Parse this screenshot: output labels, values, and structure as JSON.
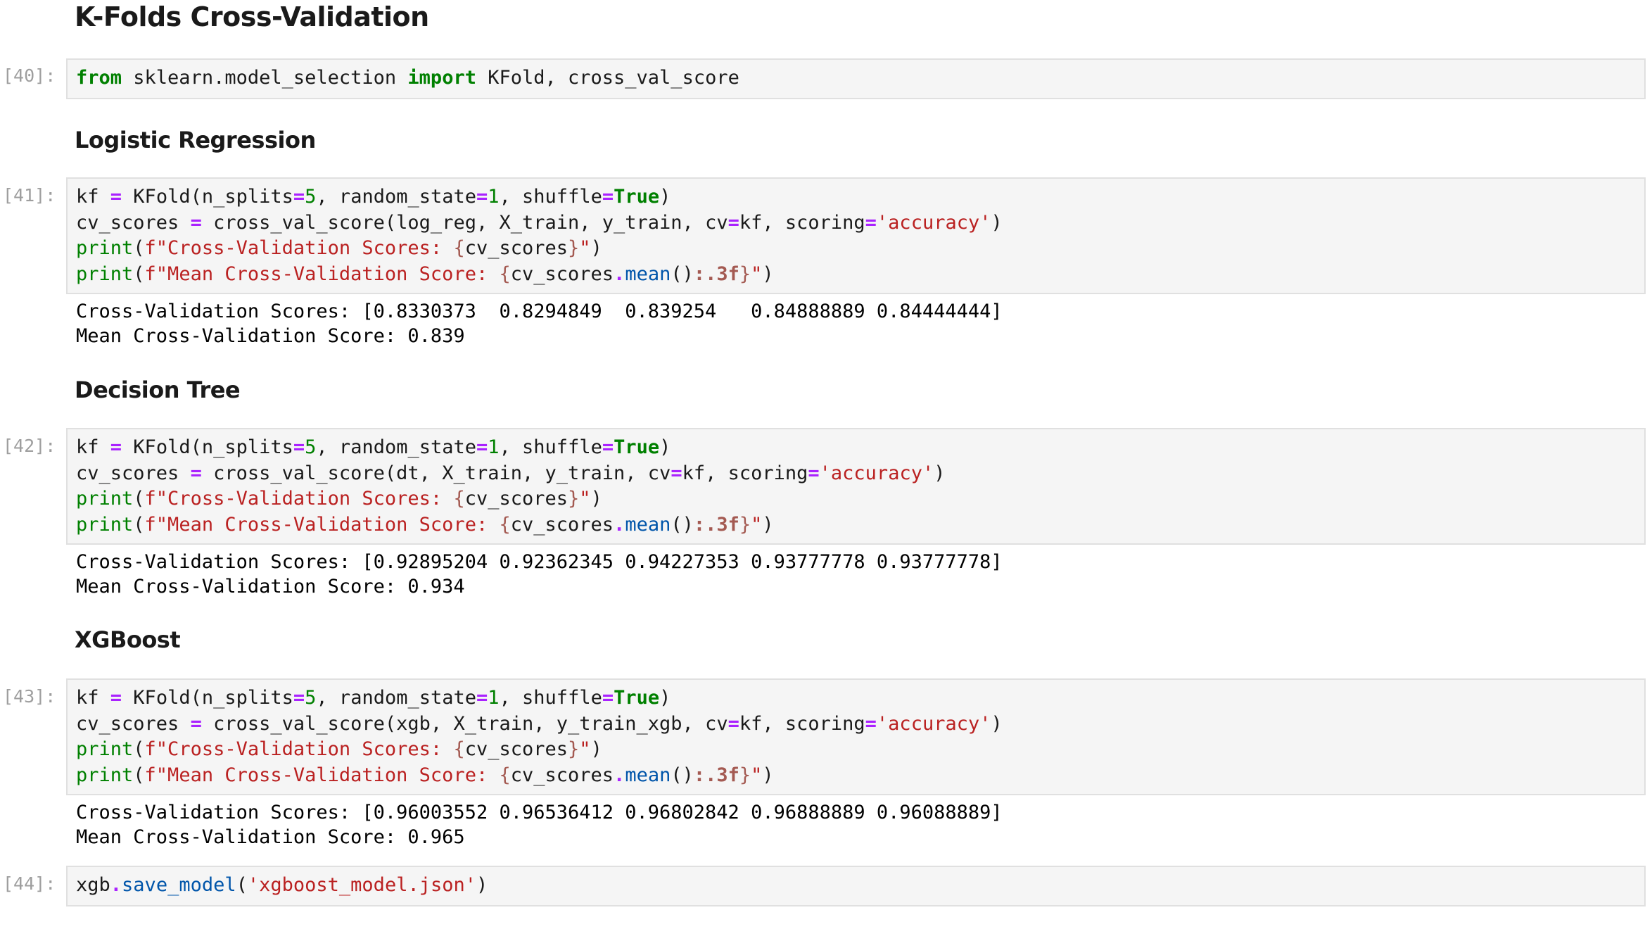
{
  "headings": {
    "main": "K-Folds Cross-Validation",
    "logreg": "Logistic Regression",
    "dtree": "Decision Tree",
    "xgb": "XGBoost"
  },
  "cells": [
    {
      "prompt": "[40]:",
      "code": [
        "from sklearn.model_selection import KFold, cross_val_score"
      ],
      "output": []
    },
    {
      "prompt": "[41]:",
      "code": [
        "kf = KFold(n_splits=5, random_state=1, shuffle=True)",
        "cv_scores = cross_val_score(log_reg, X_train, y_train, cv=kf, scoring='accuracy')",
        "print(f\"Cross-Validation Scores: {cv_scores}\")",
        "print(f\"Mean Cross-Validation Score: {cv_scores.mean():.3f}\")"
      ],
      "output": [
        "Cross-Validation Scores: [0.8330373  0.8294849  0.839254   0.84888889 0.84444444]",
        "Mean Cross-Validation Score: 0.839"
      ]
    },
    {
      "prompt": "[42]:",
      "code": [
        "kf = KFold(n_splits=5, random_state=1, shuffle=True)",
        "cv_scores = cross_val_score(dt, X_train, y_train, cv=kf, scoring='accuracy')",
        "print(f\"Cross-Validation Scores: {cv_scores}\")",
        "print(f\"Mean Cross-Validation Score: {cv_scores.mean():.3f}\")"
      ],
      "output": [
        "Cross-Validation Scores: [0.92895204 0.92362345 0.94227353 0.93777778 0.93777778]",
        "Mean Cross-Validation Score: 0.934"
      ]
    },
    {
      "prompt": "[43]:",
      "code": [
        "kf = KFold(n_splits=5, random_state=1, shuffle=True)",
        "cv_scores = cross_val_score(xgb, X_train, y_train_xgb, cv=kf, scoring='accuracy')",
        "print(f\"Cross-Validation Scores: {cv_scores}\")",
        "print(f\"Mean Cross-Validation Score: {cv_scores.mean():.3f}\")"
      ],
      "output": [
        "Cross-Validation Scores: [0.96003552 0.96536412 0.96802842 0.96888889 0.96088889]",
        "Mean Cross-Validation Score: 0.965"
      ]
    },
    {
      "prompt": "[44]:",
      "code": [
        "xgb.save_model('xgboost_model.json')"
      ],
      "output": []
    }
  ]
}
